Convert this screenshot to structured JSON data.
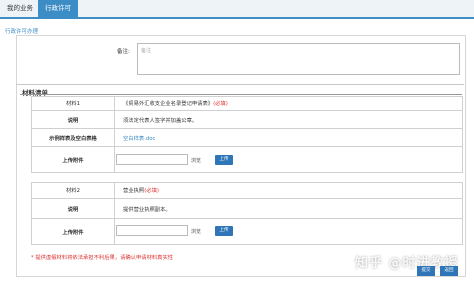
{
  "tabs": [
    {
      "label": "我的业务"
    },
    {
      "label": "行政许可"
    }
  ],
  "breadcrumb": "行政许可办理",
  "note": {
    "label": "备注:",
    "placeholder": "备注"
  },
  "materials": {
    "title": "材料清单",
    "item1": {
      "key": "材料1",
      "name": "《贸易外汇收支企业名录登记申请表》",
      "required": "(必填)",
      "desc_key": "说明",
      "desc": "须法定代表人签字并加盖公章。",
      "sample_key": "示例样表及空白表格",
      "sample_link": "空白样表.doc",
      "upload_key": "上传附件",
      "browse": "浏览",
      "upload_btn": "上传"
    },
    "item2": {
      "key": "材料2",
      "name": "营业执照",
      "required": "(必填)",
      "desc_key": "说明",
      "desc": "提供营业执照副本。",
      "upload_key": "上传附件",
      "browse": "浏览",
      "upload_btn": "上传"
    }
  },
  "warning": "* 提供虚假材料将依法承担不利后果，请确认申请材料真实性",
  "buttons": {
    "submit": "提交",
    "back": "返回"
  },
  "watermark": "知乎 @时进教授",
  "colors": {
    "accent": "#3c8dc5",
    "button": "#2e76b8",
    "required": "#d33333"
  }
}
